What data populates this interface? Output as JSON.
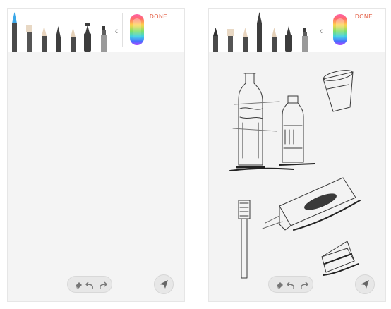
{
  "left_screen": {
    "toolbar": {
      "tools": [
        {
          "name": "brush-pen",
          "tip_color": "#3aa7e8"
        },
        {
          "name": "wide-brush"
        },
        {
          "name": "oil-pastel"
        },
        {
          "name": "pencil"
        },
        {
          "name": "marker"
        },
        {
          "name": "fountain-pen"
        },
        {
          "name": "highlighter"
        }
      ],
      "done_label": "DONE"
    }
  },
  "right_screen": {
    "toolbar": {
      "tools": [
        {
          "name": "brush-pen"
        },
        {
          "name": "wide-brush"
        },
        {
          "name": "oil-pastel"
        },
        {
          "name": "pencil",
          "selected": true
        },
        {
          "name": "marker"
        },
        {
          "name": "fountain-pen"
        },
        {
          "name": "highlighter"
        }
      ],
      "done_label": "DONE"
    }
  },
  "icons": [
    "chevron-left-icon",
    "color-palette-icon",
    "eraser-icon",
    "undo-icon",
    "redo-icon",
    "send-icon"
  ],
  "colors": {
    "accent": "#e2553a",
    "canvas": "#f4f4f4",
    "tool_body": "#4a4a4a"
  }
}
